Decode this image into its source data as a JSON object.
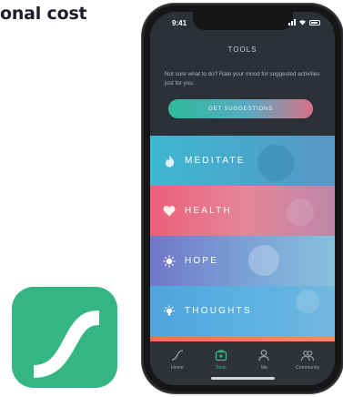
{
  "heading": "onal cost",
  "app_icon": {
    "icon": "sanvello-wave-logo",
    "color": "#33b584"
  },
  "phone": {
    "status": {
      "time": "9:41"
    },
    "header": {
      "title": "TOOLS"
    },
    "prompt": "Not sure what to do? Rate your mood for suggested activities just for you.",
    "suggest_button": "GET SUGGESTIONS",
    "tools": [
      {
        "label": "MEDITATE",
        "icon": "flame-icon"
      },
      {
        "label": "HEALTH",
        "icon": "heart-icon"
      },
      {
        "label": "HOPE",
        "icon": "sun-icon"
      },
      {
        "label": "THOUGHTS",
        "icon": "lightbulb-icon"
      }
    ],
    "tabs": [
      {
        "label": "Home",
        "icon": "wave-icon"
      },
      {
        "label": "Tools",
        "icon": "toolbox-icon",
        "active": true
      },
      {
        "label": "Me",
        "icon": "person-icon"
      },
      {
        "label": "Community",
        "icon": "people-icon"
      }
    ],
    "colors": {
      "active_tab": "#2ec089",
      "accent_green": "#33b584"
    }
  }
}
